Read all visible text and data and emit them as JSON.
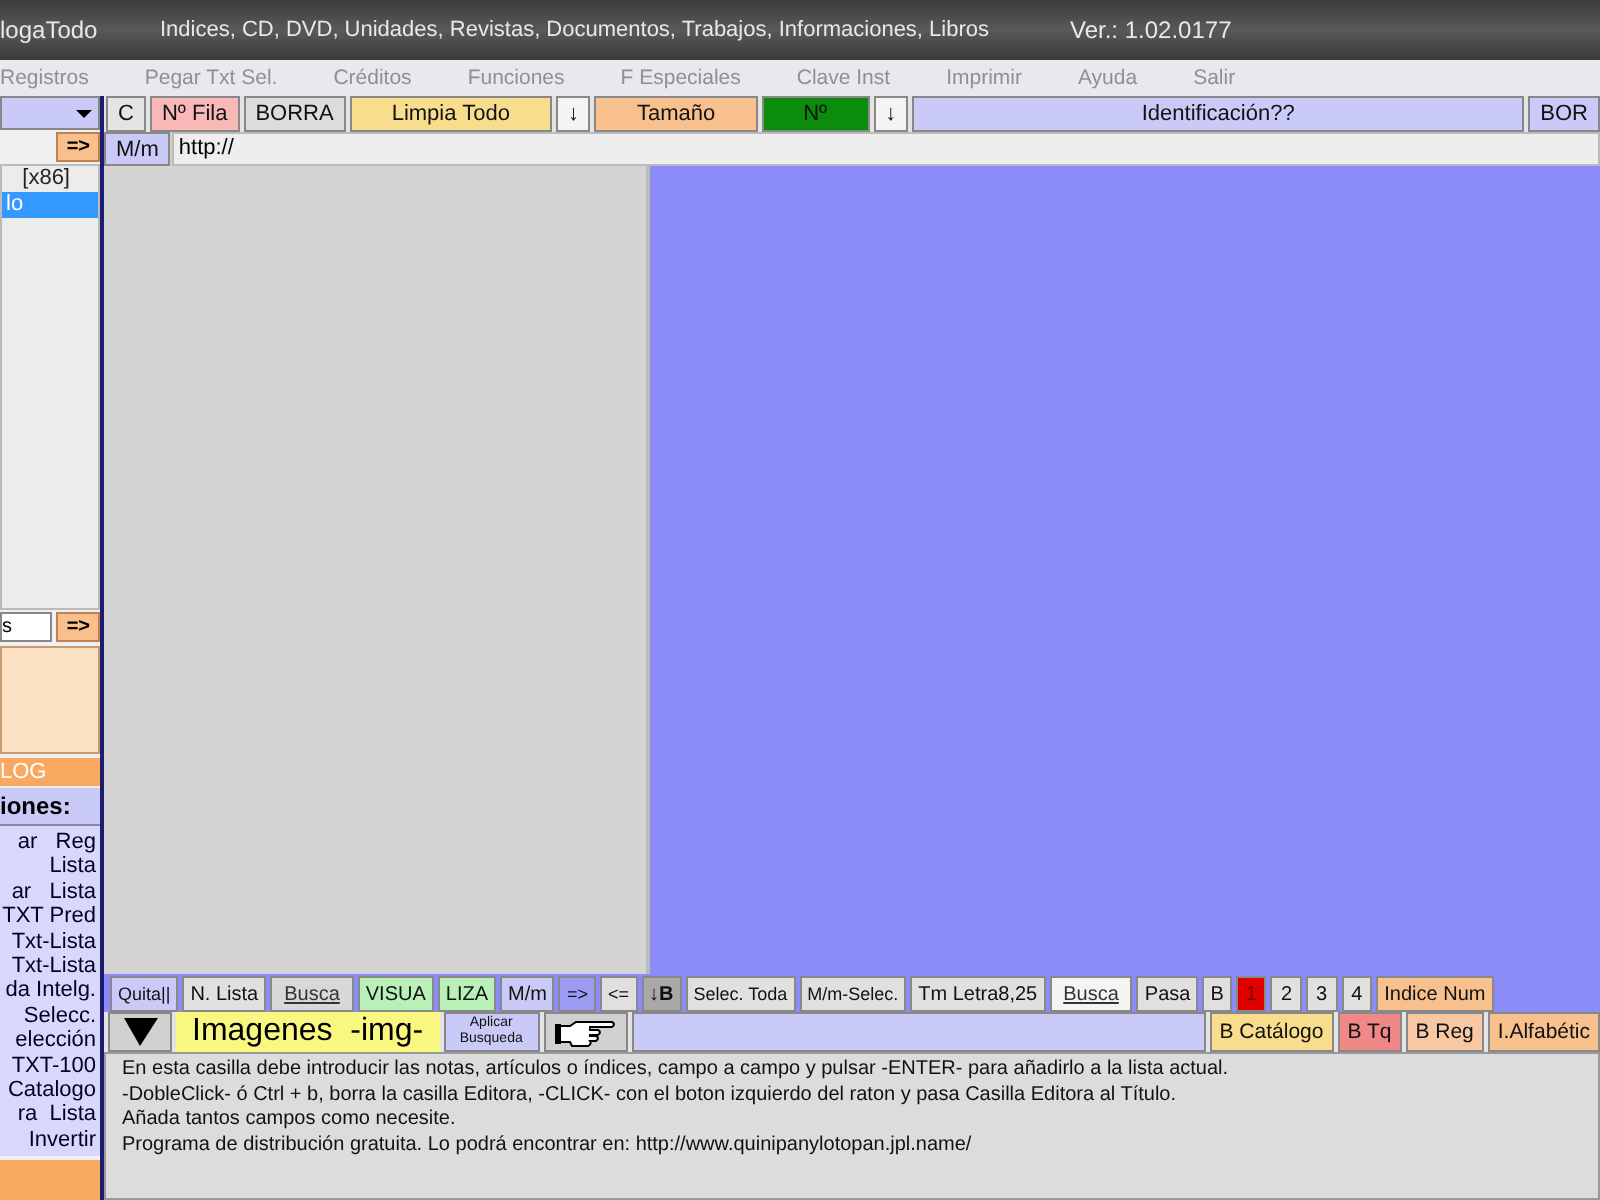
{
  "window": {
    "app": "logaTodo",
    "title": "Indices,  CD, DVD, Unidades, Revistas, Documentos, Trabajos, Informaciones, Libros",
    "version": "Ver.: 1.02.0177"
  },
  "menu": [
    "Registros",
    "Pegar Txt Sel.",
    "Créditos",
    "Funciones",
    "F Especiales",
    "Clave Inst",
    "Imprimir",
    "Ayuda",
    "Salir"
  ],
  "toolbar": [
    {
      "kind": "button",
      "label": "C",
      "color": "#e4e4e4"
    },
    {
      "kind": "button",
      "label": "Nº Fila",
      "color": "#f8b8b8"
    },
    {
      "kind": "button",
      "label": "BORRA",
      "color": "#dcdcdc"
    },
    {
      "kind": "wide",
      "label": "Limpia Todo",
      "color": "#f8de8c"
    },
    {
      "kind": "button",
      "label": "↓",
      "color": "#f4f4f4"
    },
    {
      "kind": "wide",
      "label": "Tamaño",
      "color": "#f8c08c"
    },
    {
      "kind": "wide",
      "label": "Nº",
      "color": "#0c8c0c"
    },
    {
      "kind": "button",
      "label": "↓",
      "color": "#f4f4f4"
    },
    {
      "kind": "fill",
      "label": "Identificación??",
      "color": "#cacaf8"
    },
    {
      "kind": "button",
      "label": "BOR",
      "color": "#cacaf8"
    }
  ],
  "url_row": {
    "case_button": "M/m",
    "url": "http://"
  },
  "left": {
    "arrow_button": "=>",
    "list": [
      {
        "label": "[x86]",
        "selected": false
      },
      {
        "label": "lo",
        "selected": true
      }
    ],
    "search_value": "s",
    "search_button": "=>",
    "log_label": "LOG",
    "options_title": "iones:",
    "options": [
      "ar   Reg",
      "Lista",
      "ar   Lista",
      "TXT Pred",
      "Txt-Lista",
      "Txt-Lista",
      "da Intelg.",
      "Selecc.",
      "elección",
      "TXT-100",
      "Catalogo",
      "ra  Lista",
      "Invertir"
    ]
  },
  "bottom_row": [
    {
      "kind": "small",
      "label": "Quita||",
      "color": "#cacaf8"
    },
    {
      "kind": "button",
      "label": "N. Lista",
      "color": "#e0e0e0"
    },
    {
      "kind": "link",
      "label": "Busca",
      "color": "#d8d8d8"
    },
    {
      "kind": "button",
      "label": "VISUA",
      "color": "#b8f0b8"
    },
    {
      "kind": "button",
      "label": "LIZA",
      "color": "#b8f0b8"
    },
    {
      "kind": "button",
      "label": "M/m",
      "color": "#cacaf8"
    },
    {
      "kind": "small",
      "label": "=>",
      "color": "#9c9cf4"
    },
    {
      "kind": "small",
      "label": "<=",
      "color": "#e0e0e0"
    },
    {
      "kind": "bold",
      "label": "↓B",
      "color": "#a8a8a8"
    },
    {
      "kind": "small",
      "label": "Selec. Toda",
      "color": "#e0e0e0"
    },
    {
      "kind": "small",
      "label": "M/m-Selec.",
      "color": "#e0e0e0"
    },
    {
      "kind": "button",
      "label": "Tm Letra8,25",
      "color": "#e0e0e0"
    },
    {
      "kind": "link",
      "label": "Busca",
      "color": "#f4f4f4"
    },
    {
      "kind": "button",
      "label": "Pasa",
      "color": "#e0e0e0"
    },
    {
      "kind": "button",
      "label": "B",
      "color": "#e0e0e0"
    },
    {
      "kind": "page",
      "label": "1",
      "selected": true,
      "color": "#e00000"
    },
    {
      "kind": "page",
      "label": "2",
      "selected": false,
      "color": "#e0e0e0"
    },
    {
      "kind": "page",
      "label": "3",
      "selected": false,
      "color": "#e0e0e0"
    },
    {
      "kind": "page",
      "label": "4",
      "selected": false,
      "color": "#e0e0e0"
    },
    {
      "kind": "button",
      "label": "Indice Num",
      "color": "#f8c08c"
    }
  ],
  "image_row": {
    "images_label": "Imagenes  -img-",
    "apply_button": "Aplicar Busqueda",
    "buttons": [
      {
        "label": "B Catálogo",
        "color": "#f8de8c"
      },
      {
        "label": "B Tq",
        "color": "#f08888"
      },
      {
        "label": "B Reg",
        "color": "#f8c8a4"
      },
      {
        "label": "I.Alfabétic",
        "color": "#f8c08c"
      }
    ]
  },
  "help": [
    "En esta casilla debe introducir las notas, artículos o índices, campo a campo y pulsar -ENTER- para añadirlo a la lista actual.",
    "-DobleClick- ó Ctrl + b, borra la casilla Editora, -CLICK- con el boton izquierdo del raton y pasa Casilla Editora al Título.",
    "Añada tantos campos como necesite.",
    "Programa de distribución gratuita. Lo podrá encontrar en:  http://www.quinipanylotopan.jpl.name/"
  ]
}
